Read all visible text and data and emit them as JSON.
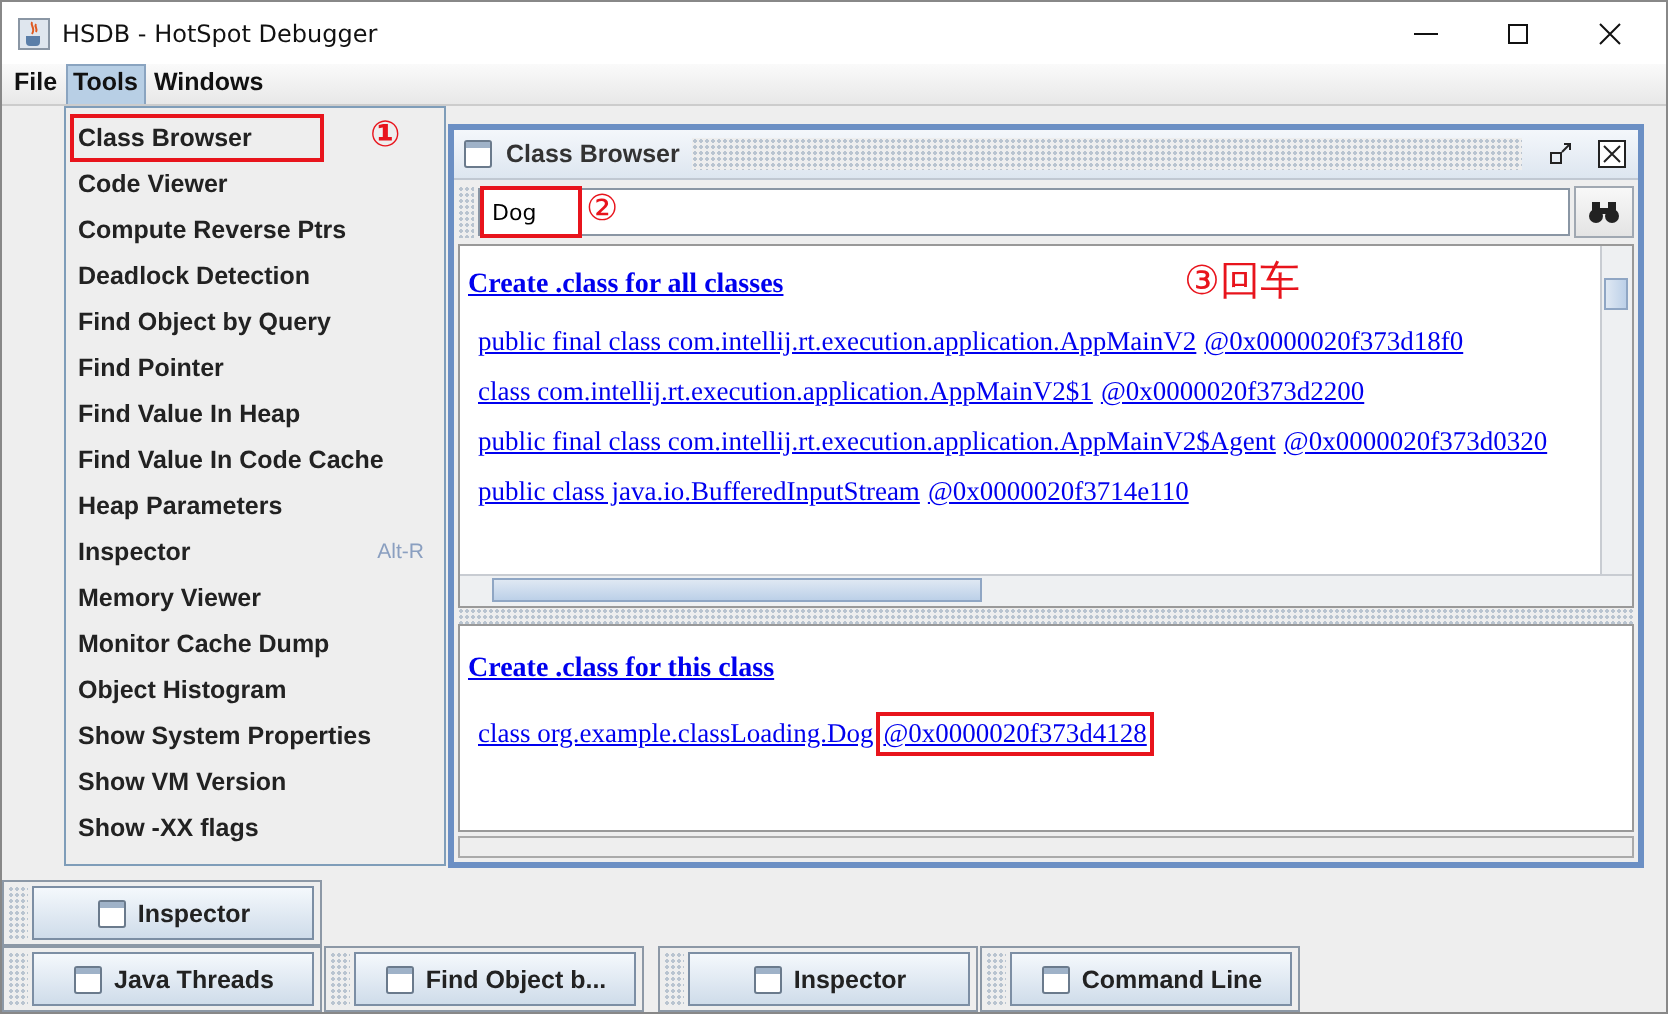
{
  "window": {
    "title": "HSDB - HotSpot Debugger"
  },
  "menu_bar": [
    {
      "label": "File",
      "selected": false
    },
    {
      "label": "Tools",
      "selected": true
    },
    {
      "label": "Windows",
      "selected": false
    }
  ],
  "tools_menu": {
    "items": [
      {
        "label": "Class Browser",
        "highlighted": true,
        "callout": "①"
      },
      {
        "label": "Code Viewer",
        "highlighted": false
      },
      {
        "label": "Compute Reverse Ptrs",
        "highlighted": false
      },
      {
        "label": "Deadlock Detection",
        "highlighted": false
      },
      {
        "label": "Find Object by Query",
        "highlighted": false
      },
      {
        "label": "Find Pointer",
        "highlighted": false
      },
      {
        "label": "Find Value In Heap",
        "highlighted": false
      },
      {
        "label": "Find Value In Code Cache",
        "highlighted": false
      },
      {
        "label": "Heap Parameters",
        "highlighted": false
      },
      {
        "label": "Inspector",
        "shortcut": "Alt-R",
        "highlighted": false
      },
      {
        "label": "Memory Viewer",
        "highlighted": false
      },
      {
        "label": "Monitor Cache Dump",
        "highlighted": false
      },
      {
        "label": "Object Histogram",
        "highlighted": false
      },
      {
        "label": "Show System Properties",
        "highlighted": false
      },
      {
        "label": "Show VM Version",
        "highlighted": false
      },
      {
        "label": "Show -XX flags",
        "highlighted": false
      }
    ]
  },
  "class_browser": {
    "title": "Class Browser",
    "search": {
      "value": "Dog",
      "highlighted": true,
      "callout": "②"
    },
    "annotation": "③回车",
    "all_classes": {
      "heading": "Create .class for all classes",
      "rows": [
        {
          "name": "public final class com.intellij.rt.execution.application.AppMainV2",
          "address": "@0x0000020f373d18f0",
          "highlighted": false
        },
        {
          "name": "class com.intellij.rt.execution.application.AppMainV2$1",
          "address": "@0x0000020f373d2200",
          "highlighted": false
        },
        {
          "name": "public final class com.intellij.rt.execution.application.AppMainV2$Agent",
          "address": "@0x0000020f373d0320",
          "highlighted": false
        },
        {
          "name": "public class java.io.BufferedInputStream",
          "address": "@0x0000020f3714e110",
          "highlighted": false
        }
      ]
    },
    "this_class": {
      "heading": "Create .class for this class",
      "rows": [
        {
          "name": "class org.example.classLoading.Dog",
          "address": "@0x0000020f373d4128",
          "highlighted": true
        }
      ]
    }
  },
  "frame_bar_rows": [
    {
      "buttons": [
        {
          "label": "Inspector"
        }
      ]
    },
    {
      "buttons": [
        {
          "label": "Java Threads"
        },
        {
          "label": "Find Object b..."
        },
        {
          "label": "Inspector"
        },
        {
          "label": "Command Line"
        }
      ]
    }
  ]
}
